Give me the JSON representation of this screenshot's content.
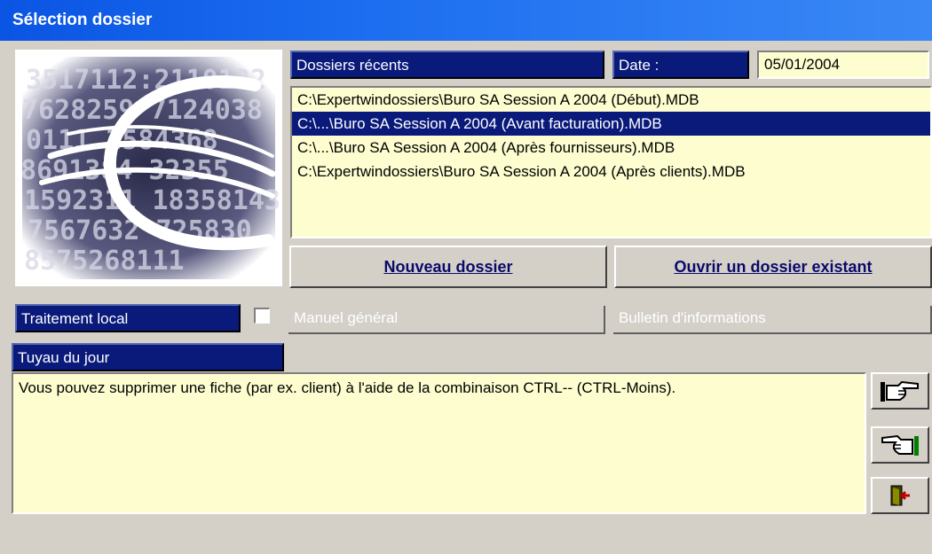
{
  "window": {
    "title": "Sélection dossier"
  },
  "recent": {
    "header": "Dossiers récents",
    "date_label": "Date :",
    "date_value": "05/01/2004",
    "items": [
      "C:\\Expertwindossiers\\Buro SA Session A 2004 (Début).MDB",
      "C:\\...\\Buro SA Session A 2004 (Avant facturation).MDB",
      "C:\\...\\Buro SA Session A 2004 (Après fournisseurs).MDB",
      "C:\\Expertwindossiers\\Buro SA Session A 2004 (Après clients).MDB"
    ],
    "selected_index": 1
  },
  "buttons": {
    "new_mnemonic": "N",
    "new_rest": "ouveau dossier",
    "open_mnemonic": "O",
    "open_rest": "uvrir un dossier existant"
  },
  "options": {
    "local_label": "Traitement local",
    "local_checked": false,
    "manual_label": "Manuel général",
    "bulletin_label": "Bulletin d'informations"
  },
  "tip": {
    "header": "Tuyau du jour",
    "text": "Vous pouvez supprimer une fiche (par ex. client) à l'aide de la combinaison CTRL-- (CTRL-Moins)."
  },
  "side_icons": [
    "next-hand-icon",
    "previous-hand-icon",
    "exit-door-icon"
  ],
  "colors": {
    "header": "#0a1a7a",
    "field": "#fdfdd0",
    "face": "#d4d0c8",
    "titlebar": "#0a55e3"
  }
}
